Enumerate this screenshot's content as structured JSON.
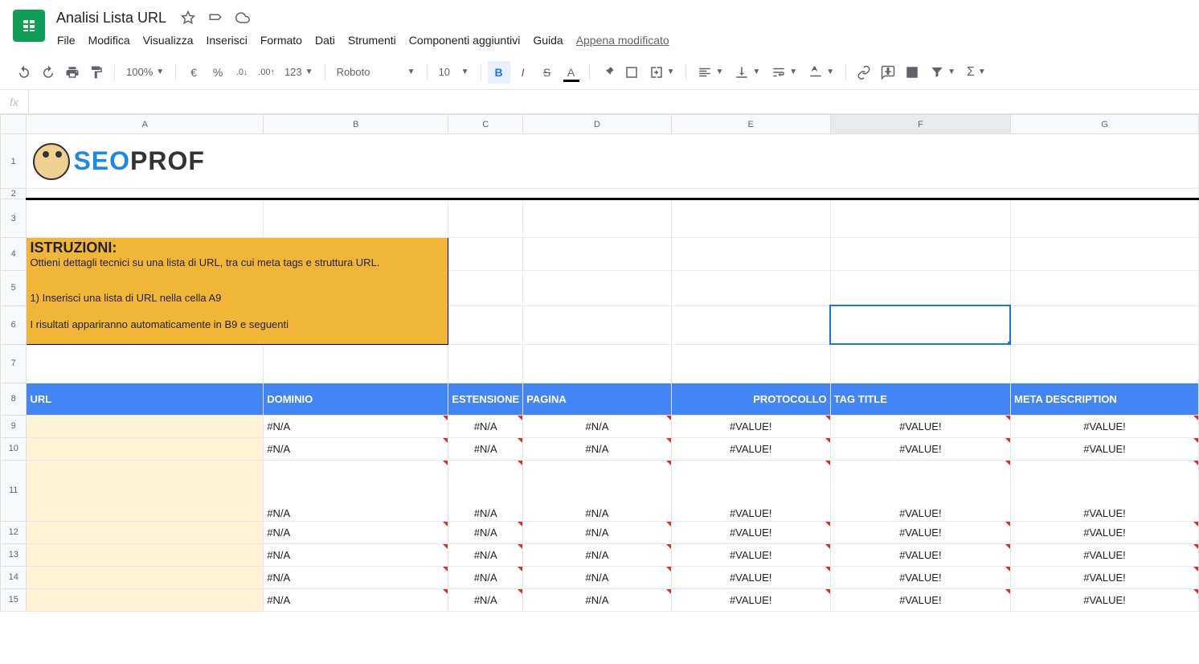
{
  "doc": {
    "title": "Analisi Lista URL",
    "last_edit": "Appena modificato"
  },
  "menu": {
    "file": "File",
    "edit": "Modifica",
    "view": "Visualizza",
    "insert": "Inserisci",
    "format": "Formato",
    "data": "Dati",
    "tools": "Strumenti",
    "addons": "Componenti aggiuntivi",
    "help": "Guida"
  },
  "toolbar": {
    "zoom": "100%",
    "currency": "€",
    "percent": "%",
    "dec_minus": ".0",
    "dec_plus": ".00",
    "num_format": "123",
    "font": "Roboto",
    "font_size": "10"
  },
  "formula": {
    "fx": "fx",
    "value": ""
  },
  "columns": [
    "A",
    "B",
    "C",
    "D",
    "E",
    "F",
    "G"
  ],
  "logo": {
    "seo": "SEO",
    "prof": "PROF"
  },
  "instructions": {
    "title": "ISTRUZIONI:",
    "desc": "Ottieni dettagli tecnici su una lista di URL, tra cui meta tags e struttura URL.",
    "step1": "1) Inserisci una lista di URL nella cella A9",
    "step2": "I risultati appariranno automaticamente in B9 e seguenti"
  },
  "table_headers": {
    "url": "URL",
    "dominio": "DOMINIO",
    "estensione": "ESTENSIONE",
    "pagina": "PAGINA",
    "protocollo": "PROTOCOLLO",
    "tag_title": "TAG TITLE",
    "meta_desc": "META DESCRIPTION"
  },
  "errors": {
    "na": "#N/A",
    "value": "#VALUE!"
  },
  "row_numbers": [
    "1",
    "2",
    "3",
    "4",
    "5",
    "6",
    "7",
    "8",
    "9",
    "10",
    "11",
    "12",
    "13",
    "14",
    "15"
  ],
  "selected_cell": "F6"
}
